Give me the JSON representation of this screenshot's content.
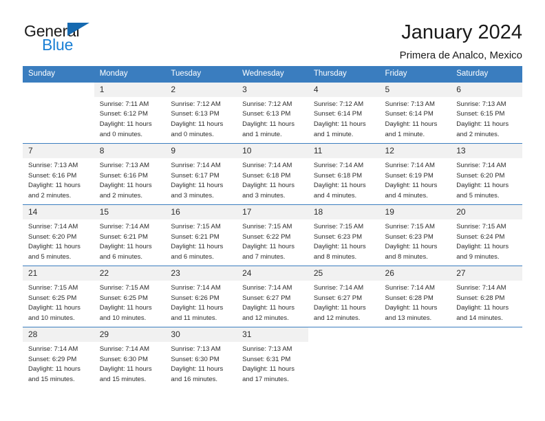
{
  "brand": {
    "name_part1": "General",
    "name_part2": "Blue"
  },
  "header": {
    "title": "January 2024",
    "subtitle": "Primera de Analco, Mexico"
  },
  "weekdays": [
    "Sunday",
    "Monday",
    "Tuesday",
    "Wednesday",
    "Thursday",
    "Friday",
    "Saturday"
  ],
  "colors": {
    "header_blue": "#3a7dbf",
    "daynum_band": "#f1f1f1",
    "brand_blue": "#1a7fd4",
    "text": "#2b2b2b"
  },
  "weeks": [
    [
      {
        "day": "",
        "sunrise": "",
        "sunset": "",
        "daylight1": "",
        "daylight2": ""
      },
      {
        "day": "1",
        "sunrise": "Sunrise: 7:11 AM",
        "sunset": "Sunset: 6:12 PM",
        "daylight1": "Daylight: 11 hours",
        "daylight2": "and 0 minutes."
      },
      {
        "day": "2",
        "sunrise": "Sunrise: 7:12 AM",
        "sunset": "Sunset: 6:13 PM",
        "daylight1": "Daylight: 11 hours",
        "daylight2": "and 0 minutes."
      },
      {
        "day": "3",
        "sunrise": "Sunrise: 7:12 AM",
        "sunset": "Sunset: 6:13 PM",
        "daylight1": "Daylight: 11 hours",
        "daylight2": "and 1 minute."
      },
      {
        "day": "4",
        "sunrise": "Sunrise: 7:12 AM",
        "sunset": "Sunset: 6:14 PM",
        "daylight1": "Daylight: 11 hours",
        "daylight2": "and 1 minute."
      },
      {
        "day": "5",
        "sunrise": "Sunrise: 7:13 AM",
        "sunset": "Sunset: 6:14 PM",
        "daylight1": "Daylight: 11 hours",
        "daylight2": "and 1 minute."
      },
      {
        "day": "6",
        "sunrise": "Sunrise: 7:13 AM",
        "sunset": "Sunset: 6:15 PM",
        "daylight1": "Daylight: 11 hours",
        "daylight2": "and 2 minutes."
      }
    ],
    [
      {
        "day": "7",
        "sunrise": "Sunrise: 7:13 AM",
        "sunset": "Sunset: 6:16 PM",
        "daylight1": "Daylight: 11 hours",
        "daylight2": "and 2 minutes."
      },
      {
        "day": "8",
        "sunrise": "Sunrise: 7:13 AM",
        "sunset": "Sunset: 6:16 PM",
        "daylight1": "Daylight: 11 hours",
        "daylight2": "and 2 minutes."
      },
      {
        "day": "9",
        "sunrise": "Sunrise: 7:14 AM",
        "sunset": "Sunset: 6:17 PM",
        "daylight1": "Daylight: 11 hours",
        "daylight2": "and 3 minutes."
      },
      {
        "day": "10",
        "sunrise": "Sunrise: 7:14 AM",
        "sunset": "Sunset: 6:18 PM",
        "daylight1": "Daylight: 11 hours",
        "daylight2": "and 3 minutes."
      },
      {
        "day": "11",
        "sunrise": "Sunrise: 7:14 AM",
        "sunset": "Sunset: 6:18 PM",
        "daylight1": "Daylight: 11 hours",
        "daylight2": "and 4 minutes."
      },
      {
        "day": "12",
        "sunrise": "Sunrise: 7:14 AM",
        "sunset": "Sunset: 6:19 PM",
        "daylight1": "Daylight: 11 hours",
        "daylight2": "and 4 minutes."
      },
      {
        "day": "13",
        "sunrise": "Sunrise: 7:14 AM",
        "sunset": "Sunset: 6:20 PM",
        "daylight1": "Daylight: 11 hours",
        "daylight2": "and 5 minutes."
      }
    ],
    [
      {
        "day": "14",
        "sunrise": "Sunrise: 7:14 AM",
        "sunset": "Sunset: 6:20 PM",
        "daylight1": "Daylight: 11 hours",
        "daylight2": "and 5 minutes."
      },
      {
        "day": "15",
        "sunrise": "Sunrise: 7:14 AM",
        "sunset": "Sunset: 6:21 PM",
        "daylight1": "Daylight: 11 hours",
        "daylight2": "and 6 minutes."
      },
      {
        "day": "16",
        "sunrise": "Sunrise: 7:15 AM",
        "sunset": "Sunset: 6:21 PM",
        "daylight1": "Daylight: 11 hours",
        "daylight2": "and 6 minutes."
      },
      {
        "day": "17",
        "sunrise": "Sunrise: 7:15 AM",
        "sunset": "Sunset: 6:22 PM",
        "daylight1": "Daylight: 11 hours",
        "daylight2": "and 7 minutes."
      },
      {
        "day": "18",
        "sunrise": "Sunrise: 7:15 AM",
        "sunset": "Sunset: 6:23 PM",
        "daylight1": "Daylight: 11 hours",
        "daylight2": "and 8 minutes."
      },
      {
        "day": "19",
        "sunrise": "Sunrise: 7:15 AM",
        "sunset": "Sunset: 6:23 PM",
        "daylight1": "Daylight: 11 hours",
        "daylight2": "and 8 minutes."
      },
      {
        "day": "20",
        "sunrise": "Sunrise: 7:15 AM",
        "sunset": "Sunset: 6:24 PM",
        "daylight1": "Daylight: 11 hours",
        "daylight2": "and 9 minutes."
      }
    ],
    [
      {
        "day": "21",
        "sunrise": "Sunrise: 7:15 AM",
        "sunset": "Sunset: 6:25 PM",
        "daylight1": "Daylight: 11 hours",
        "daylight2": "and 10 minutes."
      },
      {
        "day": "22",
        "sunrise": "Sunrise: 7:15 AM",
        "sunset": "Sunset: 6:25 PM",
        "daylight1": "Daylight: 11 hours",
        "daylight2": "and 10 minutes."
      },
      {
        "day": "23",
        "sunrise": "Sunrise: 7:14 AM",
        "sunset": "Sunset: 6:26 PM",
        "daylight1": "Daylight: 11 hours",
        "daylight2": "and 11 minutes."
      },
      {
        "day": "24",
        "sunrise": "Sunrise: 7:14 AM",
        "sunset": "Sunset: 6:27 PM",
        "daylight1": "Daylight: 11 hours",
        "daylight2": "and 12 minutes."
      },
      {
        "day": "25",
        "sunrise": "Sunrise: 7:14 AM",
        "sunset": "Sunset: 6:27 PM",
        "daylight1": "Daylight: 11 hours",
        "daylight2": "and 12 minutes."
      },
      {
        "day": "26",
        "sunrise": "Sunrise: 7:14 AM",
        "sunset": "Sunset: 6:28 PM",
        "daylight1": "Daylight: 11 hours",
        "daylight2": "and 13 minutes."
      },
      {
        "day": "27",
        "sunrise": "Sunrise: 7:14 AM",
        "sunset": "Sunset: 6:28 PM",
        "daylight1": "Daylight: 11 hours",
        "daylight2": "and 14 minutes."
      }
    ],
    [
      {
        "day": "28",
        "sunrise": "Sunrise: 7:14 AM",
        "sunset": "Sunset: 6:29 PM",
        "daylight1": "Daylight: 11 hours",
        "daylight2": "and 15 minutes."
      },
      {
        "day": "29",
        "sunrise": "Sunrise: 7:14 AM",
        "sunset": "Sunset: 6:30 PM",
        "daylight1": "Daylight: 11 hours",
        "daylight2": "and 15 minutes."
      },
      {
        "day": "30",
        "sunrise": "Sunrise: 7:13 AM",
        "sunset": "Sunset: 6:30 PM",
        "daylight1": "Daylight: 11 hours",
        "daylight2": "and 16 minutes."
      },
      {
        "day": "31",
        "sunrise": "Sunrise: 7:13 AM",
        "sunset": "Sunset: 6:31 PM",
        "daylight1": "Daylight: 11 hours",
        "daylight2": "and 17 minutes."
      },
      {
        "day": "",
        "sunrise": "",
        "sunset": "",
        "daylight1": "",
        "daylight2": ""
      },
      {
        "day": "",
        "sunrise": "",
        "sunset": "",
        "daylight1": "",
        "daylight2": ""
      },
      {
        "day": "",
        "sunrise": "",
        "sunset": "",
        "daylight1": "",
        "daylight2": ""
      }
    ]
  ]
}
